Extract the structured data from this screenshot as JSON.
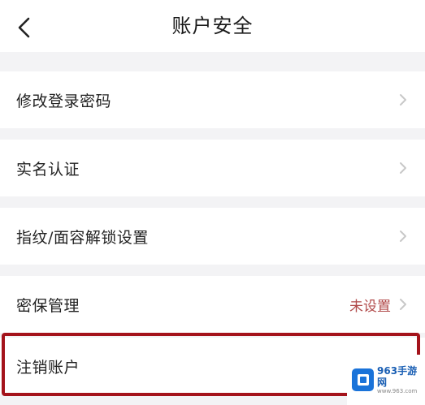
{
  "header": {
    "title": "账户安全",
    "back_icon": "chevron-left-icon"
  },
  "menu": {
    "items": [
      {
        "label": "修改登录密码",
        "value": "",
        "icon": "chevron-right-icon"
      },
      {
        "label": "实名认证",
        "value": "",
        "icon": "chevron-right-icon"
      },
      {
        "label": "指纹/面容解锁设置",
        "value": "",
        "icon": "chevron-right-icon"
      },
      {
        "label": "密保管理",
        "value": "未设置",
        "icon": "chevron-right-icon"
      },
      {
        "label": "注销账户",
        "value": "",
        "icon": "chevron-right-icon"
      }
    ]
  },
  "highlight": {
    "color": "#a4131b"
  },
  "watermark": {
    "name": "963手游网",
    "url": "www.963.com"
  }
}
